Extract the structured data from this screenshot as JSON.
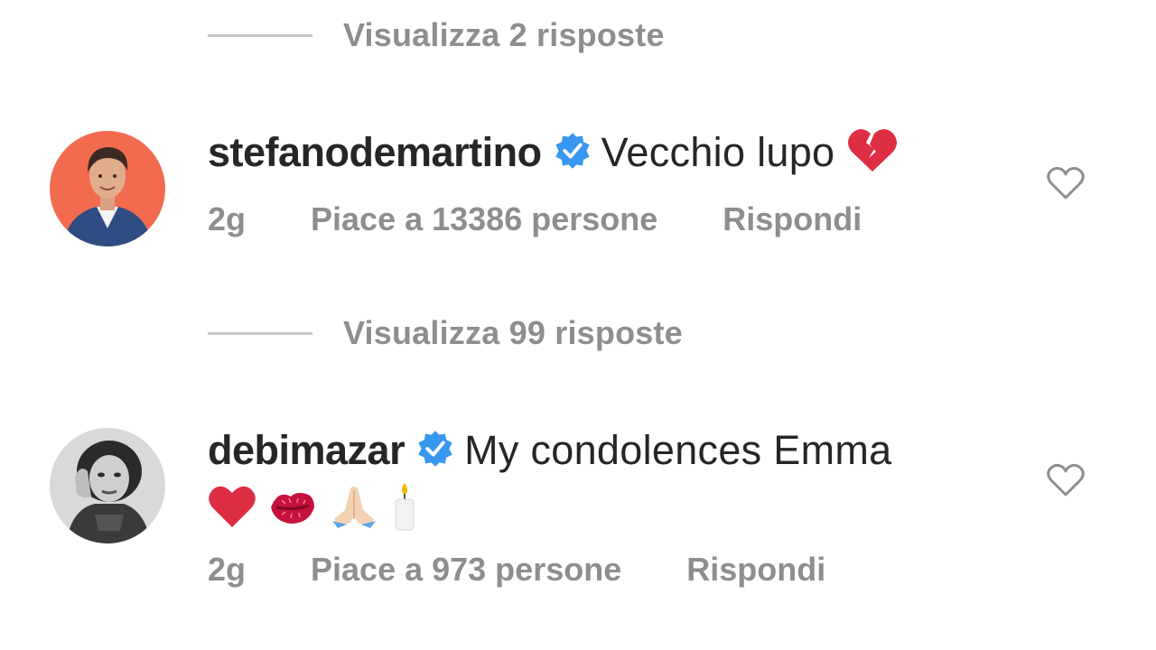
{
  "thread": {
    "view_replies_1": "Visualizza 2 risposte",
    "view_replies_2": "Visualizza 99 risposte"
  },
  "comments": [
    {
      "username": "stefanodemartino",
      "verified": true,
      "text": "Vecchio lupo",
      "emojis": [
        "broken-heart"
      ],
      "time": "2g",
      "likes": "Piace a 13386 persone",
      "reply_label": "Rispondi"
    },
    {
      "username": "debimazar",
      "verified": true,
      "text": "My condolences Emma",
      "emojis": [
        "red-heart",
        "kiss-mark",
        "folded-hands",
        "candle"
      ],
      "time": "2g",
      "likes": "Piace a 973 persone",
      "reply_label": "Rispondi"
    }
  ],
  "colors": {
    "text_primary": "#262626",
    "text_secondary": "#8e8e8e",
    "verified_blue": "#3897f0",
    "divider": "#c7c7c7",
    "avatar1_bg": "#f26b4f"
  }
}
